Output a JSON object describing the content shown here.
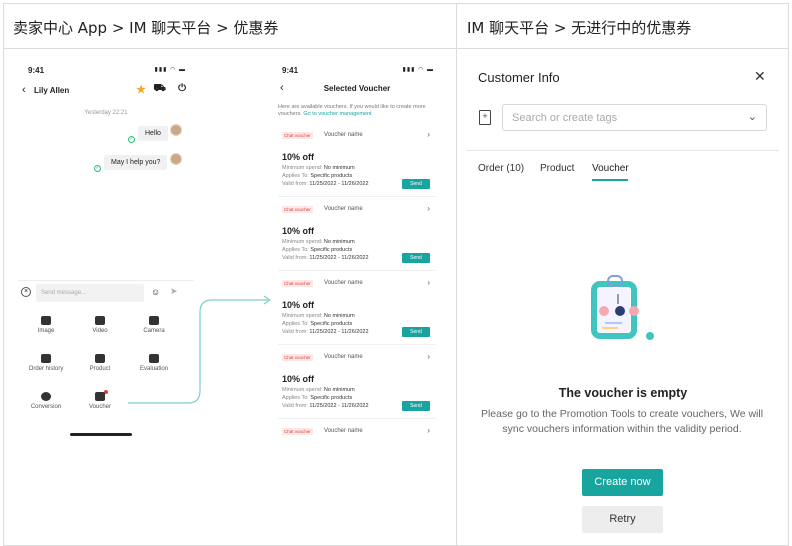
{
  "sections": {
    "left_title": "卖家中心 App > IM 聊天平台 > 优惠券",
    "right_title": "IM 聊天平台 > 无进行中的优惠券"
  },
  "chat_phone": {
    "time": "9:41",
    "signal": "▮▮▮ ◠ ▬",
    "contact_name": "Lily Allen",
    "timestamp": "Yesterday 22:21",
    "messages": [
      {
        "text": "Hello"
      },
      {
        "text": "May I help you?"
      }
    ],
    "input_placeholder": "Send message...",
    "tools": [
      {
        "label": "Image",
        "icon": "image-icon"
      },
      {
        "label": "Video",
        "icon": "video-icon"
      },
      {
        "label": "Camera",
        "icon": "camera-icon"
      },
      {
        "label": "Order history",
        "icon": "order-history-icon"
      },
      {
        "label": "Product",
        "icon": "product-icon"
      },
      {
        "label": "Evaluation",
        "icon": "evaluation-icon"
      },
      {
        "label": "Conversion",
        "icon": "conversion-icon"
      },
      {
        "label": "Voucher",
        "icon": "voucher-icon"
      }
    ]
  },
  "voucher_phone": {
    "time": "9:41",
    "signal": "▮▮▮ ◠ ▬",
    "title": "Selected Voucher",
    "desc": "Here are available vouchers. If you would like to create more vouchers. ",
    "desc_link": "Go to voucher management",
    "vouchers": [
      {
        "tag": "Chat voucher",
        "name": "Voucher name",
        "off": "10% off",
        "min_label": "Minimum spend:",
        "min_value": "No minimum",
        "applies_label": "Applies To:",
        "applies_value": "Specific products",
        "valid_label": "Valid from:",
        "valid_value": "11/25/2022 - 11/26/2022",
        "send": "Send"
      },
      {
        "tag": "Chat voucher",
        "name": "Voucher name",
        "off": "10% off",
        "min_label": "Minimum spend:",
        "min_value": "No minimum",
        "applies_label": "Applies To:",
        "applies_value": "Specific products",
        "valid_label": "Valid from:",
        "valid_value": "11/25/2022 - 11/26/2022",
        "send": "Send"
      },
      {
        "tag": "Chat voucher",
        "name": "Voucher name",
        "off": "10% off",
        "min_label": "Minimum spend:",
        "min_value": "No minimum",
        "applies_label": "Applies To:",
        "applies_value": "Specific products",
        "valid_label": "Valid from:",
        "valid_value": "11/25/2022 - 11/26/2022",
        "send": "Send"
      },
      {
        "tag": "Chat voucher",
        "name": "Voucher name",
        "off": "10% off",
        "min_label": "Minimum spend:",
        "min_value": "No minimum",
        "applies_label": "Applies To:",
        "applies_value": "Specific products",
        "valid_label": "Valid from:",
        "valid_value": "11/25/2022 - 11/26/2022",
        "send": "Send"
      }
    ],
    "last_voucher": {
      "tag": "Chat voucher",
      "name": "Voucher name"
    }
  },
  "customer_panel": {
    "title": "Customer Info",
    "tag_placeholder": "Search or create tags",
    "tabs": [
      {
        "label": "Order (10)",
        "active": false
      },
      {
        "label": "Product",
        "active": false
      },
      {
        "label": "Voucher",
        "active": true
      }
    ],
    "empty_title": "The voucher is empty",
    "empty_desc": "Please go to the Promotion Tools to create vouchers, We will sync vouchers information within the validity period.",
    "create_button": "Create now",
    "retry_button": "Retry"
  },
  "colors": {
    "accent": "#18a5a0",
    "star": "#f5a623",
    "tag_red": "#e23b3b"
  }
}
